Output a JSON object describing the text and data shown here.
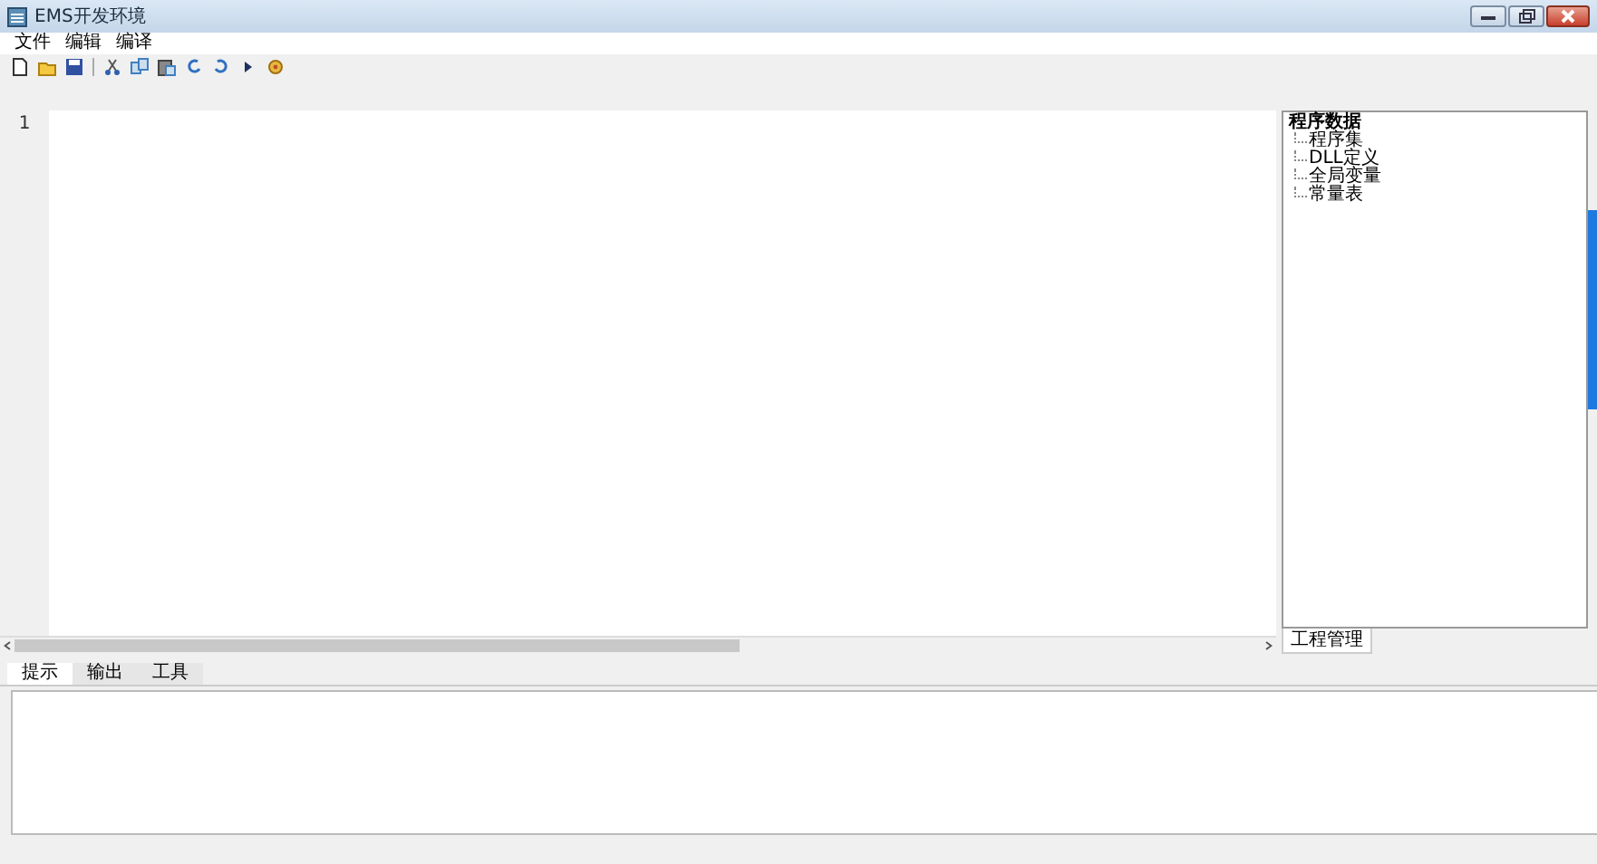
{
  "window": {
    "title": "EMS开发环境"
  },
  "menu": [
    "文件",
    "编辑",
    "编译"
  ],
  "toolbar": [
    {
      "kind": "new"
    },
    {
      "kind": "open"
    },
    {
      "kind": "save"
    },
    {
      "kind": "sep"
    },
    {
      "kind": "cut"
    },
    {
      "kind": "copy"
    },
    {
      "kind": "paste"
    },
    {
      "kind": "redo"
    },
    {
      "kind": "undo"
    },
    {
      "kind": "run"
    },
    {
      "kind": "stop"
    }
  ],
  "editor": {
    "line_numbers": [
      "1"
    ]
  },
  "project_tree": {
    "label": "程序数据",
    "children": [
      {
        "label": "程序集"
      },
      {
        "label": "DLL定义"
      },
      {
        "label": "全局变量"
      },
      {
        "label": "常量表"
      }
    ]
  },
  "side_tabs": [
    {
      "label": "工程管理",
      "selected": true
    }
  ],
  "bottom_tabs": [
    {
      "label": "提示",
      "selected": true
    },
    {
      "label": "输出",
      "selected": false
    },
    {
      "label": "工具",
      "selected": false
    }
  ]
}
